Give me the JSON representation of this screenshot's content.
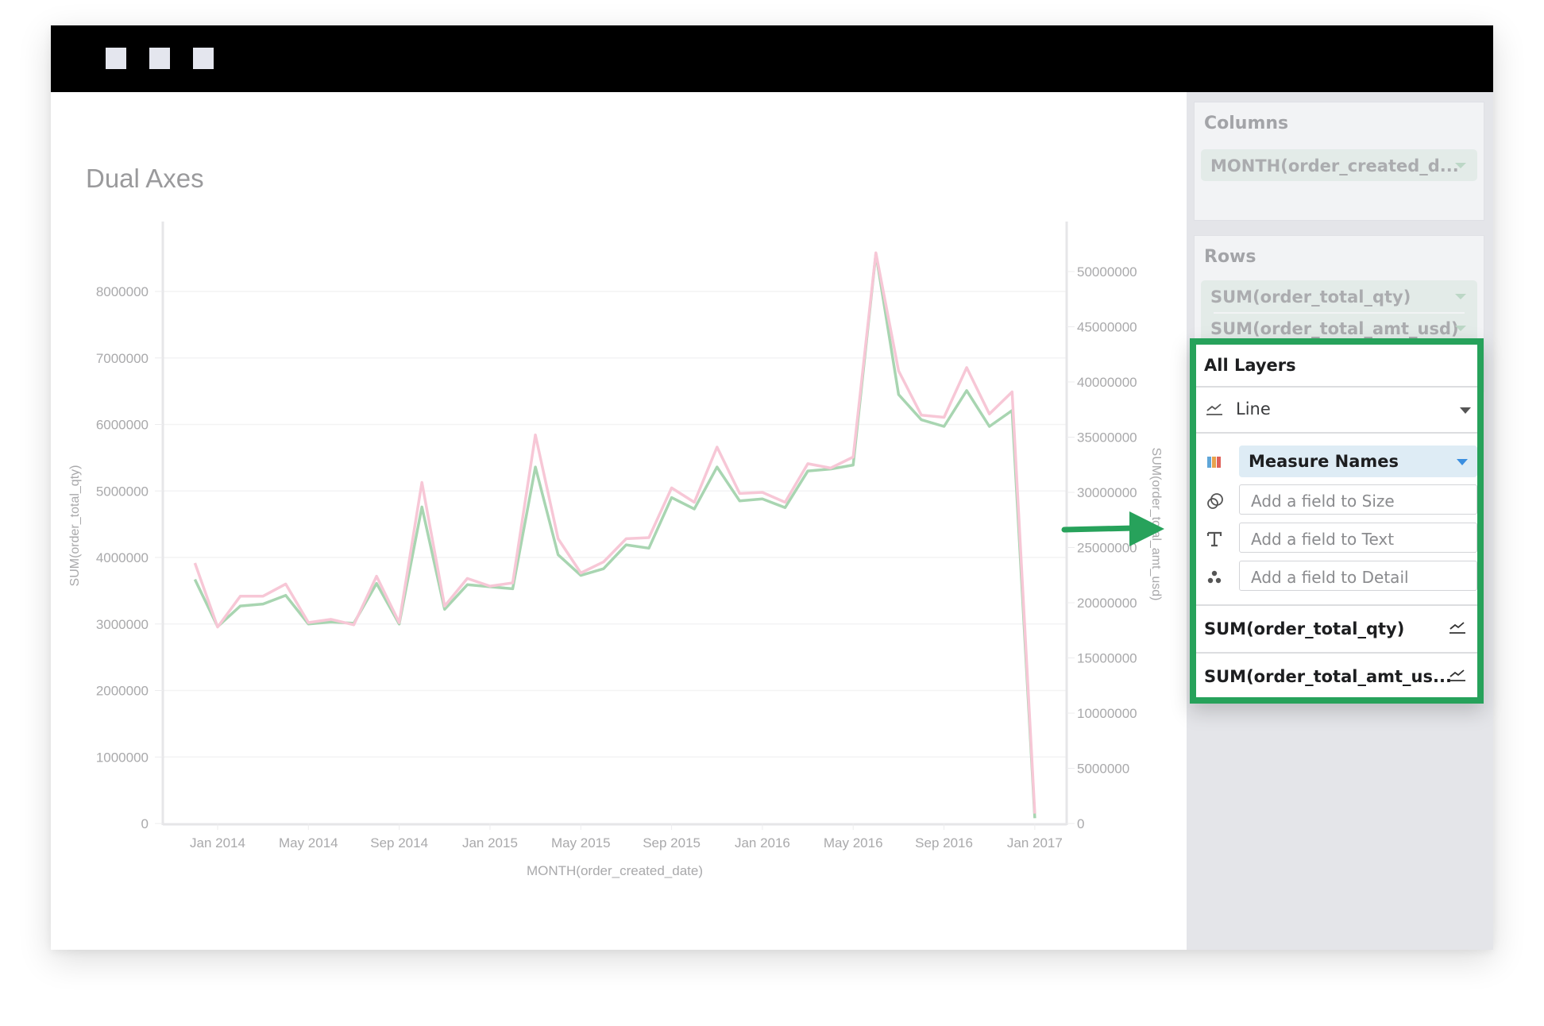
{
  "window": {
    "titlebar_buttons": [
      "window-button-1",
      "window-button-2",
      "window-button-3"
    ]
  },
  "chart_title": "Dual Axes",
  "sidebar": {
    "columns": {
      "title": "Columns",
      "pills": [
        {
          "label": "MONTH(order_created_d...",
          "icon": "caret-down-icon"
        }
      ]
    },
    "rows": {
      "title": "Rows",
      "pills": [
        {
          "label": "SUM(order_total_qty)",
          "icon": "caret-down-icon"
        },
        {
          "label": "SUM(order_total_amt_usd)",
          "icon": "caret-down-icon"
        }
      ]
    },
    "layers": {
      "title": "All Layers",
      "mark_type": {
        "label": "Line",
        "icon": "line-chart-icon"
      },
      "encodings": {
        "color": {
          "icon": "color-palette-icon",
          "value": "Measure Names"
        },
        "size": {
          "icon": "size-icon",
          "placeholder": "Add a field to Size"
        },
        "text": {
          "icon": "text-icon",
          "placeholder": "Add a field to Text"
        },
        "detail": {
          "icon": "detail-icon",
          "placeholder": "Add a field to Detail"
        }
      },
      "items": [
        {
          "label": "SUM(order_total_qty)",
          "icon": "line-chart-icon"
        },
        {
          "label": "SUM(order_total_amt_us...",
          "icon": "line-chart-icon"
        }
      ],
      "highlight_color": "#27a25b"
    }
  },
  "colors": {
    "qty_series": "#a8d5b1",
    "amt_series": "#f7c7d6",
    "highlight": "#27a25b",
    "color_legend": [
      "#5fa6d8",
      "#e8a24e",
      "#e0625a"
    ]
  },
  "chart_data": {
    "type": "line",
    "title": "Dual Axes",
    "xlabel": "MONTH(order_created_date)",
    "ylabel": "SUM(order_total_qty)",
    "ylabel_right": "SUM(order_total_amt_usd)",
    "x": [
      "2013-12",
      "2014-01",
      "2014-02",
      "2014-03",
      "2014-04",
      "2014-05",
      "2014-06",
      "2014-07",
      "2014-08",
      "2014-09",
      "2014-10",
      "2014-11",
      "2014-12",
      "2015-01",
      "2015-02",
      "2015-03",
      "2015-04",
      "2015-05",
      "2015-06",
      "2015-07",
      "2015-08",
      "2015-09",
      "2015-10",
      "2015-11",
      "2015-12",
      "2016-01",
      "2016-02",
      "2016-03",
      "2016-04",
      "2016-05",
      "2016-06",
      "2016-07",
      "2016-08",
      "2016-09",
      "2016-10",
      "2016-11",
      "2016-12",
      "2017-01"
    ],
    "x_tick_labels": [
      "Jan 2014",
      "May 2014",
      "Sep 2014",
      "Jan 2015",
      "May 2015",
      "Sep 2015",
      "Jan 2016",
      "May 2016",
      "Sep 2016",
      "Jan 2017"
    ],
    "x_tick_months": [
      "2014-01",
      "2014-05",
      "2014-09",
      "2015-01",
      "2015-05",
      "2015-09",
      "2016-01",
      "2016-05",
      "2016-09",
      "2017-01"
    ],
    "ylim": [
      0,
      8000000
    ],
    "y_ticks": [
      0,
      1000000,
      2000000,
      3000000,
      4000000,
      5000000,
      6000000,
      7000000,
      8000000
    ],
    "y_tick_labels": [
      "0",
      "1000000",
      "2000000",
      "3000000",
      "4000000",
      "5000000",
      "6000000",
      "7000000",
      "8000000"
    ],
    "ylim_right": [
      0,
      50000000
    ],
    "y_ticks_right": [
      0,
      5000000,
      10000000,
      15000000,
      20000000,
      25000000,
      30000000,
      35000000,
      40000000,
      45000000,
      50000000
    ],
    "y_tick_labels_right": [
      "0",
      "5000000",
      "10000000",
      "15000000",
      "20000000",
      "25000000",
      "30000000",
      "35000000",
      "40000000",
      "45000000",
      "50000000"
    ],
    "grid": true,
    "legend": "none",
    "series": [
      {
        "name": "SUM(order_total_qty)",
        "axis": "left",
        "color": "#a8d5b1",
        "values": [
          3670000,
          2960000,
          3270000,
          3300000,
          3430000,
          3000000,
          3030000,
          3010000,
          3610000,
          3000000,
          4760000,
          3220000,
          3590000,
          3560000,
          3530000,
          5360000,
          4040000,
          3730000,
          3830000,
          4190000,
          4140000,
          4900000,
          4730000,
          5360000,
          4850000,
          4880000,
          4750000,
          5300000,
          5330000,
          5390000,
          8570000,
          6450000,
          6070000,
          5970000,
          6510000,
          5970000,
          6210000,
          80000
        ]
      },
      {
        "name": "SUM(order_total_amt_usd)",
        "axis": "right",
        "color": "#f7c7d6",
        "values": [
          23600000,
          17800000,
          20600000,
          20600000,
          21700000,
          18200000,
          18500000,
          18000000,
          22400000,
          18200000,
          30900000,
          19700000,
          22200000,
          21500000,
          21800000,
          35200000,
          25800000,
          22700000,
          23700000,
          25800000,
          25900000,
          30400000,
          29100000,
          34100000,
          29900000,
          30000000,
          29100000,
          32600000,
          32200000,
          33200000,
          51700000,
          41000000,
          37000000,
          36800000,
          41300000,
          37100000,
          39100000,
          900000
        ]
      }
    ]
  }
}
